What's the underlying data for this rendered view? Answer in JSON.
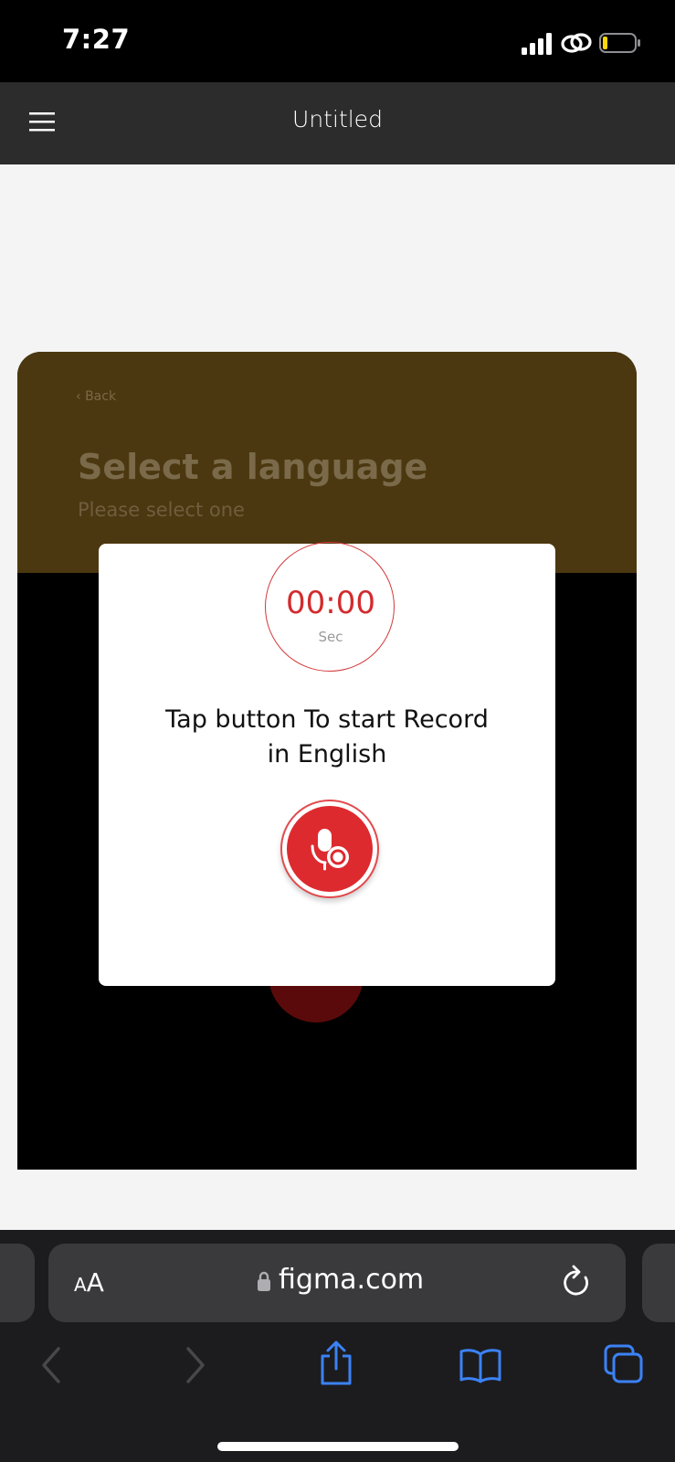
{
  "status_bar": {
    "time": "7:27"
  },
  "figma_header": {
    "file_title": "Untitled"
  },
  "frame": {
    "back_label": "Back",
    "title": "Select a language",
    "subtitle": "Please select one"
  },
  "modal": {
    "timer_value": "00:00",
    "timer_unit": "Sec",
    "instruction_line1": "Tap button To start Record",
    "instruction_line2": "in English"
  },
  "safari": {
    "text_size_label_small": "A",
    "text_size_label_large": "A",
    "url": "figma.com"
  },
  "colors": {
    "accent_red": "#dd2a2f",
    "header_brown": "#4c3810",
    "figma_bar": "#2c2c2c",
    "safari_link_blue": "#3b82f6"
  },
  "icons": [
    "menu-icon",
    "chevron-left-icon",
    "microphone-icon",
    "lock-icon",
    "reload-icon",
    "share-icon",
    "bookmarks-icon",
    "tabs-icon",
    "signal-icon",
    "link-icon",
    "battery-icon"
  ]
}
